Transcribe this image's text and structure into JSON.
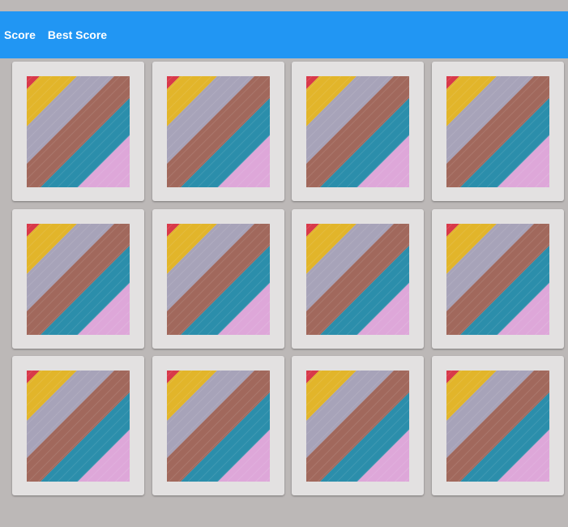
{
  "header": {
    "score_label": "Score",
    "best_score_label": "Best Score"
  },
  "colors": {
    "header_bg": "#2196f3",
    "page_bg": "#bcb8b7",
    "card_bg": "#e3e1e1",
    "stripe_red": "#d8394a",
    "stripe_yellow": "#e2b52a",
    "stripe_lavender": "#a7a3b9",
    "stripe_brown": "#a1685c",
    "stripe_teal": "#2b8eab",
    "stripe_pink": "#dea7d9"
  },
  "board": {
    "card_back_icon": "diagonal-wood-stripes-pattern",
    "cards": [
      {
        "state": "face-down"
      },
      {
        "state": "face-down"
      },
      {
        "state": "face-down"
      },
      {
        "state": "face-down"
      },
      {
        "state": "face-down"
      },
      {
        "state": "face-down"
      },
      {
        "state": "face-down"
      },
      {
        "state": "face-down"
      },
      {
        "state": "face-down"
      },
      {
        "state": "face-down"
      },
      {
        "state": "face-down"
      },
      {
        "state": "face-down"
      }
    ]
  }
}
